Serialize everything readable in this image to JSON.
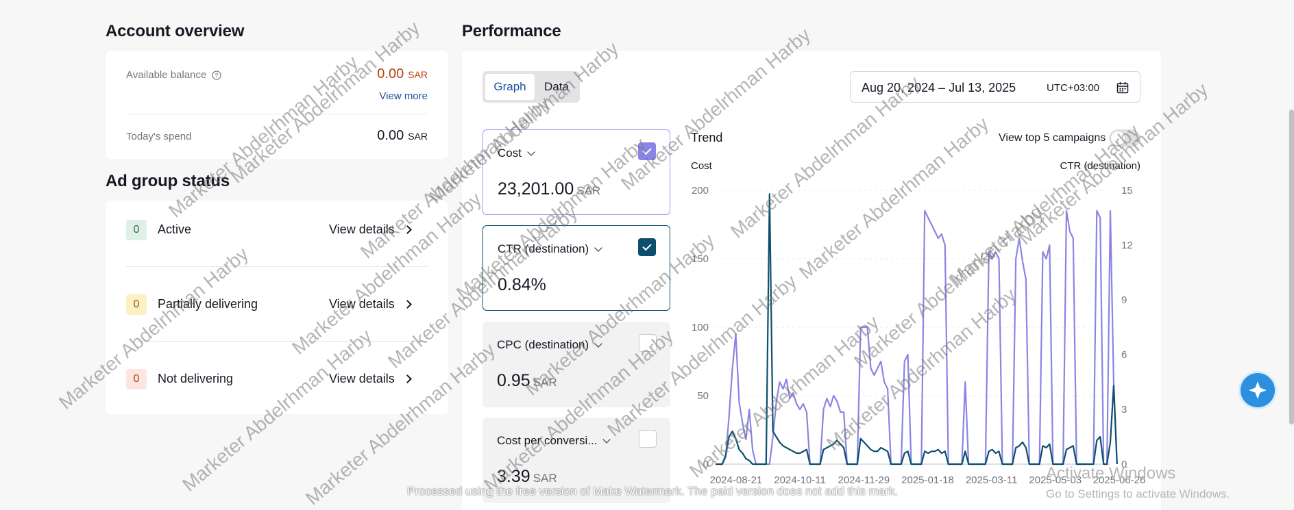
{
  "account_overview": {
    "title": "Account overview",
    "available_balance_label": "Available balance",
    "available_balance_value": "0.00",
    "available_balance_currency": "SAR",
    "view_more": "View more",
    "todays_spend_label": "Today's spend",
    "todays_spend_value": "0.00",
    "todays_spend_currency": "SAR"
  },
  "ad_group_status": {
    "title": "Ad group status",
    "items": [
      {
        "count": "0",
        "label": "Active",
        "action": "View details"
      },
      {
        "count": "0",
        "label": "Partially delivering",
        "action": "View details"
      },
      {
        "count": "0",
        "label": "Not delivering",
        "action": "View details"
      }
    ]
  },
  "performance": {
    "title": "Performance",
    "tabs": [
      {
        "label": "Graph"
      },
      {
        "label": "Data"
      }
    ],
    "date_range": "Aug 20, 2024 – Jul 13, 2025",
    "timezone": "UTC+03:00",
    "metrics": [
      {
        "title": "Cost",
        "value": "23,201.00",
        "currency": "SAR",
        "checked": true
      },
      {
        "title": "CTR (destination)",
        "value": "0.84%",
        "currency": "",
        "checked": true
      },
      {
        "title": "CPC (destination)",
        "value": "0.95",
        "currency": "SAR",
        "checked": false
      },
      {
        "title": "Cost per conversi...",
        "value": "3.39",
        "currency": "SAR",
        "checked": false
      }
    ],
    "trend_title": "Trend",
    "top5_label": "View top 5 campaigns",
    "top5_enabled": false,
    "left_axis_title": "Cost",
    "right_axis_title": "CTR (destination)"
  },
  "colors": {
    "cost_line": "#8a84e6",
    "ctr_line": "#0b4f6c",
    "accent_blue": "#1e4f9c",
    "balance_orange": "#b7410e"
  },
  "chart_data": {
    "type": "line",
    "left_ylabel": "Cost",
    "right_ylabel": "CTR (destination)",
    "left_ylim": [
      0,
      200
    ],
    "left_ticks": [
      0,
      50,
      100,
      150,
      200
    ],
    "right_ylim": [
      0,
      15
    ],
    "right_ticks": [
      0,
      3,
      6,
      9,
      12,
      15
    ],
    "x_tick_labels": [
      "2024-08-21",
      "2024-10-11",
      "2024-11-29",
      "2025-01-18",
      "2025-03-11",
      "2025-05-03",
      "2025-06-26"
    ],
    "x_count": 118,
    "series": [
      {
        "name": "Cost",
        "axis": "left",
        "values": [
          0,
          0,
          0,
          5,
          35,
          70,
          95,
          45,
          30,
          18,
          40,
          10,
          0,
          0,
          0,
          0,
          0,
          20,
          45,
          60,
          55,
          62,
          48,
          52,
          44,
          40,
          44,
          38,
          0,
          0,
          0,
          0,
          40,
          48,
          42,
          50,
          46,
          38,
          38,
          0,
          0,
          0,
          0,
          100,
          100,
          100,
          70,
          65,
          70,
          75,
          60,
          55,
          0,
          0,
          0,
          0,
          75,
          80,
          0,
          0,
          0,
          0,
          185,
          180,
          175,
          170,
          165,
          168,
          160,
          0,
          0,
          0,
          0,
          0,
          60,
          0,
          0,
          0,
          0,
          0,
          0,
          155,
          150,
          155,
          150,
          0,
          0,
          0,
          0,
          150,
          165,
          148,
          135,
          0,
          0,
          0,
          0,
          155,
          150,
          160,
          0,
          0,
          0,
          0,
          185,
          170,
          165,
          0,
          0,
          0,
          0,
          0,
          0,
          185,
          180,
          0,
          0,
          185,
          60,
          0
        ]
      },
      {
        "name": "CTR (destination)",
        "axis": "right",
        "values": [
          0,
          0,
          0,
          0.5,
          1.5,
          1.8,
          1.4,
          0.8,
          0.6,
          0.3,
          0.2,
          0,
          0,
          0,
          0,
          0,
          14.8,
          1.8,
          1.5,
          1.2,
          1.0,
          0.9,
          0.8,
          0.7,
          0.6,
          0.6,
          0.7,
          0.8,
          0,
          0,
          0,
          0,
          0.8,
          0.9,
          1.0,
          1.1,
          1.3,
          1.1,
          0.9,
          0,
          0,
          0,
          0,
          1.4,
          1.2,
          1.0,
          0.8,
          0.7,
          0.7,
          0.9,
          0.8,
          0.7,
          0,
          0,
          0,
          0,
          0.6,
          0.7,
          0,
          0,
          0,
          0,
          0.7,
          0.6,
          0.7,
          0.7,
          0.8,
          0.6,
          0.7,
          0,
          0,
          0,
          0,
          0,
          0.7,
          0,
          0,
          0,
          0,
          0,
          0,
          0.7,
          0.8,
          0.6,
          0.7,
          0,
          0,
          0,
          0,
          0.9,
          1.0,
          1.2,
          0.9,
          0,
          0,
          0,
          0,
          1.0,
          0.9,
          1.1,
          0,
          0,
          0,
          0,
          0.8,
          0.9,
          1.0,
          0,
          0,
          0,
          0,
          0,
          0,
          1.3,
          1.5,
          0,
          0,
          1.2,
          4.3,
          0
        ]
      }
    ]
  },
  "watermark": {
    "repeated_text": "Marketer Abdelrhman Harby",
    "bottom_text": "Processed using the free version of Make Watermark. The paid version does not add this mark."
  },
  "windows": {
    "activate_title": "Activate Windows",
    "activate_sub": "Go to Settings to activate Windows."
  }
}
